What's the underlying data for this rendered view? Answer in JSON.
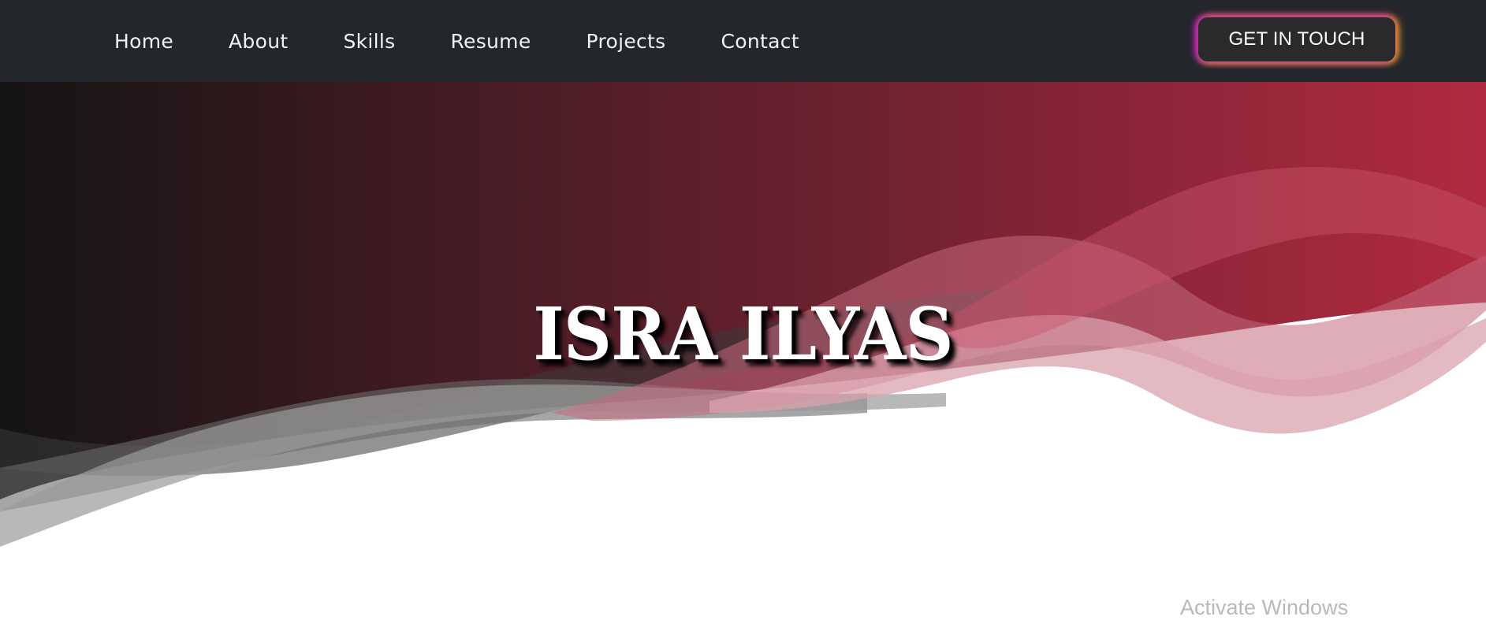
{
  "nav": {
    "links": [
      "Home",
      "About",
      "Skills",
      "Resume",
      "Projects",
      "Contact"
    ],
    "cta_label": "GET IN TOUCH"
  },
  "hero": {
    "title": "ISRA ILYAS"
  },
  "watermark": "Activate Windows",
  "colors": {
    "navbar_bg": "#23262b",
    "gradient_start": "#141414",
    "gradient_end": "#b02a40",
    "cta_glow_left": "#c21bc9",
    "cta_glow_right": "#f29d1b"
  }
}
